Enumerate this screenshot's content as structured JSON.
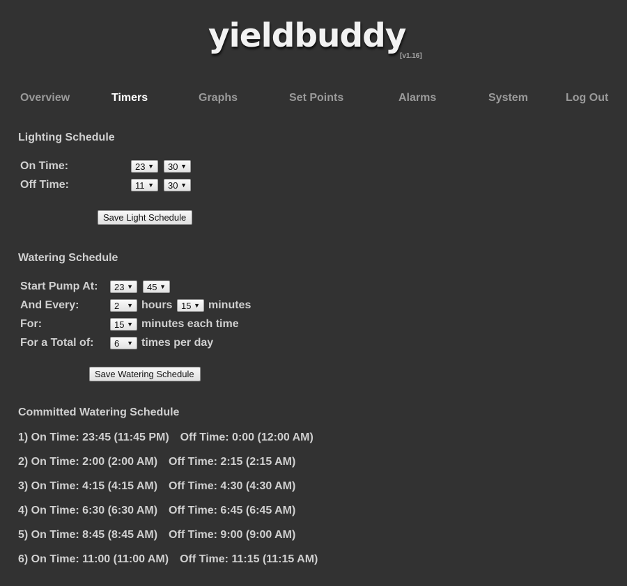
{
  "header": {
    "logo": "yieldbuddy",
    "version": "[v1.16]"
  },
  "nav": {
    "items": [
      {
        "label": "Overview",
        "active": false
      },
      {
        "label": "Timers",
        "active": true
      },
      {
        "label": "Graphs",
        "active": false
      },
      {
        "label": "Set Points",
        "active": false
      },
      {
        "label": "Alarms",
        "active": false
      },
      {
        "label": "System",
        "active": false
      },
      {
        "label": "Log Out",
        "active": false
      }
    ]
  },
  "lighting": {
    "title": "Lighting Schedule",
    "on_label": "On Time:",
    "off_label": "Off Time:",
    "on_hour": "23",
    "on_minute": "30",
    "off_hour": "11",
    "off_minute": "30",
    "save_label": "Save Light Schedule"
  },
  "watering": {
    "title": "Watering Schedule",
    "start_label": "Start Pump At:",
    "start_hour": "23",
    "start_minute": "45",
    "every_label": "And Every:",
    "every_hours": "2",
    "hours_text": "hours",
    "every_minutes": "15",
    "minutes_text": "minutes",
    "for_label": "For:",
    "for_minutes": "15",
    "for_text": "minutes each time",
    "total_label": "For a Total of:",
    "total_times": "6",
    "total_text": "times per day",
    "save_label": "Save Watering Schedule"
  },
  "committed": {
    "title": "Committed Watering Schedule",
    "entries": [
      {
        "on": "1) On Time: 23:45 (11:45 PM)",
        "off": "Off Time: 0:00 (12:00 AM)"
      },
      {
        "on": "2) On Time: 2:00 (2:00 AM)",
        "off": "Off Time: 2:15 (2:15 AM)"
      },
      {
        "on": "3) On Time: 4:15 (4:15 AM)",
        "off": "Off Time: 4:30 (4:30 AM)"
      },
      {
        "on": "4) On Time: 6:30 (6:30 AM)",
        "off": "Off Time: 6:45 (6:45 AM)"
      },
      {
        "on": "5) On Time: 8:45 (8:45 AM)",
        "off": "Off Time: 9:00 (9:00 AM)"
      },
      {
        "on": "6) On Time: 11:00 (11:00 AM)",
        "off": "Off Time: 11:15 (11:15 AM)"
      }
    ]
  },
  "icons": {
    "dropdown_arrow": "▼"
  }
}
